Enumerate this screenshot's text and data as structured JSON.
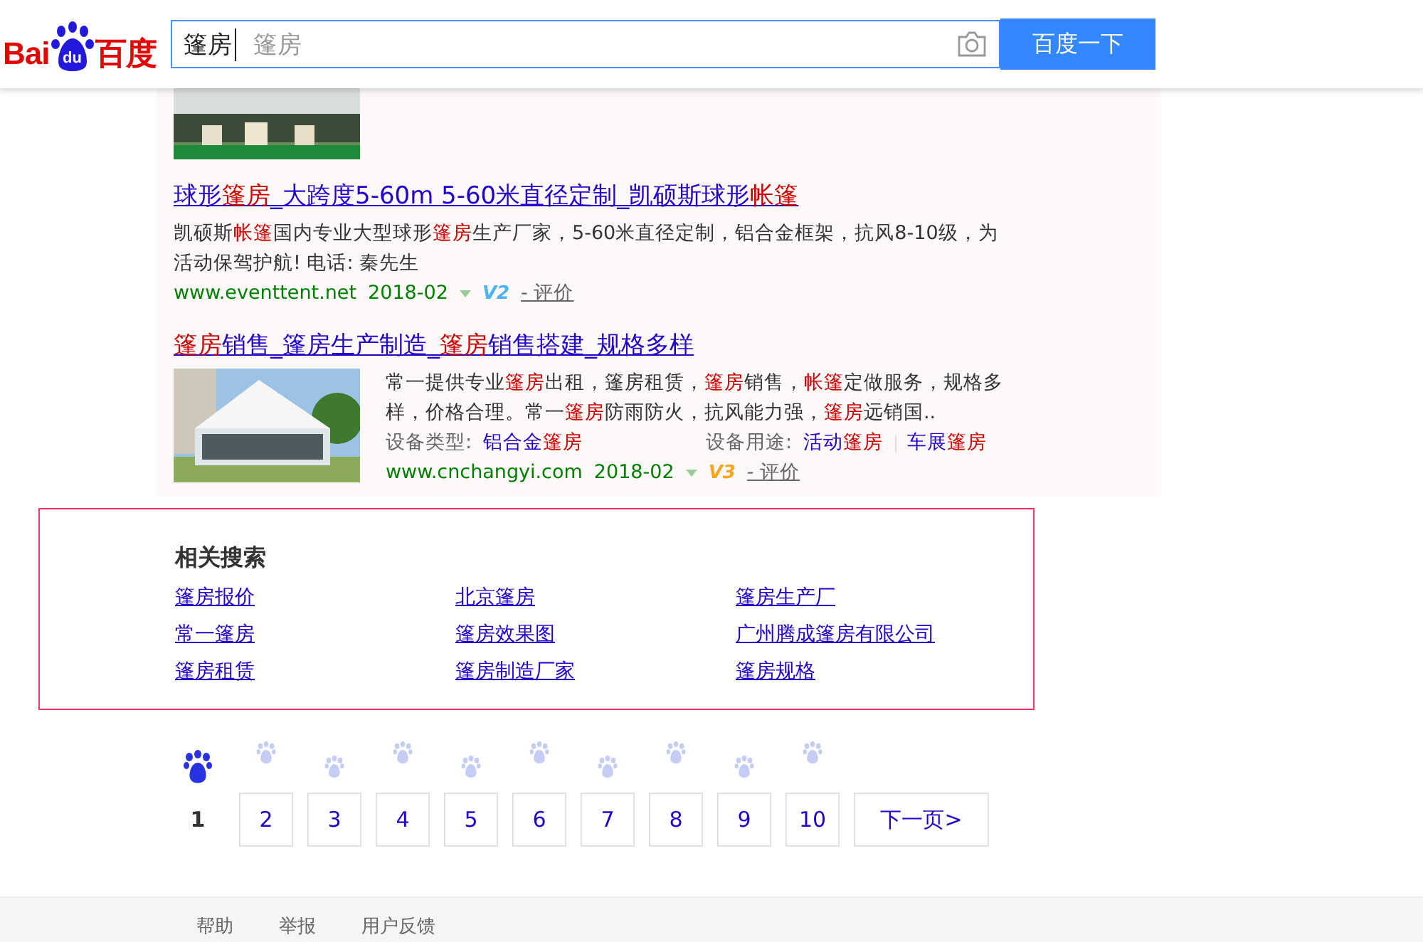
{
  "header": {
    "logo": {
      "left": "Bai",
      "paw": "du",
      "right": "百度"
    },
    "query": "篷房",
    "suggestion": "篷房",
    "submit": "百度一下"
  },
  "top_result": {
    "kind": "picture"
  },
  "results": [
    {
      "title": "球形**篷房**_大跨度5-60m 5-60米直径定制_凯硕斯球形**帐篷**",
      "abstract": "凯硕斯**帐篷**国内专业大型球形**篷房**生产厂家，5-60米直径定制，铝合金框架，抗风8-10级，为活动保驾护航! 电话: 秦先生",
      "url": "www.eventtent.net",
      "date": "2018-02",
      "badge": {
        "text": "V2",
        "color": "#4cb3f5"
      },
      "review": "- 评价"
    },
    {
      "title": "**篷房**销售_篷房生产制造_**篷房**销售搭建_规格多样",
      "image": {
        "kind": "picture"
      },
      "abstract": "常一提供专业**篷房**出租，篷房租赁，**篷房**销售，**帐篷**定做服务，规格多样，价格合理。常一**篷房**防雨防火，抗风能力强，**篷房**远销国..",
      "attrs": [
        {
          "label": "设备类型:",
          "values": [
            "铝合金**篷房**"
          ]
        },
        {
          "label": "设备用途:",
          "values": [
            "活动**篷房**",
            "车展**篷房**"
          ]
        }
      ],
      "url": "www.cnchangyi.com",
      "date": "2018-02",
      "badge": {
        "text": "V3",
        "color": "#f5a623"
      },
      "review": "- 评价"
    }
  ],
  "related": {
    "title": "相关搜索",
    "items": [
      "篷房报价",
      "北京篷房",
      "篷房生产厂",
      "常一篷房",
      "篷房效果图",
      "广州腾成篷房有限公司",
      "篷房租赁",
      "篷房制造厂家",
      "篷房规格"
    ]
  },
  "pagination": {
    "pages": [
      {
        "label": "1",
        "selected": true
      },
      {
        "label": "2",
        "selected": false
      },
      {
        "label": "3",
        "selected": false
      },
      {
        "label": "4",
        "selected": false
      },
      {
        "label": "5",
        "selected": false
      },
      {
        "label": "6",
        "selected": false
      },
      {
        "label": "7",
        "selected": false
      },
      {
        "label": "8",
        "selected": false
      },
      {
        "label": "9",
        "selected": false
      },
      {
        "label": "10",
        "selected": false
      }
    ],
    "next": "下一页>"
  },
  "footer": [
    "帮助",
    "举报",
    "用户反馈"
  ]
}
